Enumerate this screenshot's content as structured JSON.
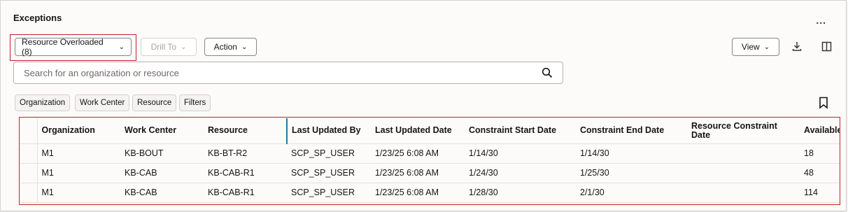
{
  "panel": {
    "title": "Exceptions",
    "overflow_label": "..."
  },
  "toolbar": {
    "exceptions_select": "Resource Overloaded (8)",
    "drill_to": "Drill To",
    "action": "Action",
    "view": "View"
  },
  "search": {
    "placeholder": "Search for an organization or resource",
    "value": ""
  },
  "filter_chips": [
    "Organization",
    "Work Center",
    "Resource",
    "Filters"
  ],
  "table": {
    "columns": [
      "Organization",
      "Work Center",
      "Resource",
      "Last Updated By",
      "Last Updated Date",
      "Constraint Start Date",
      "Constraint End Date",
      "Resource Constraint Date",
      "Available Capacity"
    ],
    "rows": [
      [
        "M1",
        "KB-BOUT",
        "KB-BT-R2",
        "SCP_SP_USER",
        "1/23/25 6:08 AM",
        "1/14/30",
        "1/14/30",
        "",
        "18"
      ],
      [
        "M1",
        "KB-CAB",
        "KB-CAB-R1",
        "SCP_SP_USER",
        "1/23/25 6:08 AM",
        "1/24/30",
        "1/25/30",
        "",
        "48"
      ],
      [
        "M1",
        "KB-CAB",
        "KB-CAB-R1",
        "SCP_SP_USER",
        "1/23/25 6:08 AM",
        "1/28/30",
        "2/1/30",
        "",
        "114"
      ]
    ]
  },
  "colors": {
    "highlight": "#c0232c",
    "column_marker": "#227e9e"
  },
  "icons": [
    "overflow-menu-icon",
    "chevron-down-icon",
    "download-icon",
    "columns-icon",
    "search-icon",
    "bookmark-icon"
  ]
}
